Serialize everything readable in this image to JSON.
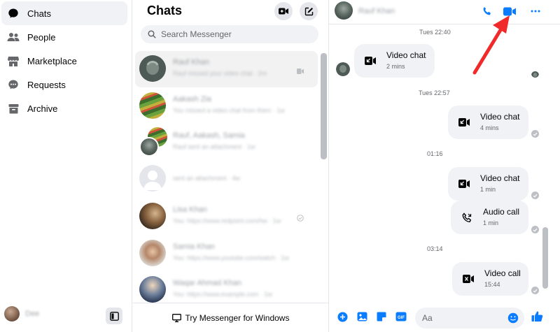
{
  "nav": {
    "items": [
      {
        "label": "Chats",
        "icon": "chat-bubble-icon",
        "active": true
      },
      {
        "label": "People",
        "icon": "people-icon",
        "active": false
      },
      {
        "label": "Marketplace",
        "icon": "marketplace-icon",
        "active": false
      },
      {
        "label": "Requests",
        "icon": "requests-icon",
        "active": false
      },
      {
        "label": "Archive",
        "icon": "archive-icon",
        "active": false
      }
    ],
    "username": "Dee"
  },
  "chat_list": {
    "title": "Chats",
    "search_placeholder": "Search Messenger",
    "conversations": [
      {
        "name": "Rauf Khan",
        "snippet": "Rauf missed your video chat · 2m",
        "active": true
      },
      {
        "name": "Aakash Zia",
        "snippet": "You missed a video chat from them · 1w",
        "active": false
      },
      {
        "name": "Rauf, Aakash, Samia",
        "snippet": "Rauf sent an attachment · 1w",
        "active": false
      },
      {
        "name": "",
        "snippet": "sent an attachment · 4w",
        "active": false
      },
      {
        "name": "Lisa Khan",
        "snippet": "You: https://www.redpoint.com/hw · 1w",
        "active": false
      },
      {
        "name": "Samia Khan",
        "snippet": "You: https://www.youtube.com/watch · 1w",
        "active": false
      },
      {
        "name": "Waqar Ahmad Khan",
        "snippet": "You: https://www.example.com · 1w",
        "active": false
      }
    ],
    "footer_label": "Try Messenger for Windows"
  },
  "conversation": {
    "contact_name": "Rauf Khan",
    "timestamps": [
      "Tues 22:40",
      "Tues 22:57",
      "01:16",
      "03:14"
    ],
    "messages": [
      {
        "title": "Video chat",
        "subtitle": "2 mins",
        "kind": "missed-video",
        "side": "left"
      },
      {
        "title": "Video chat",
        "subtitle": "4 mins",
        "kind": "missed-video",
        "side": "right"
      },
      {
        "title": "Video chat",
        "subtitle": "1 min",
        "kind": "missed-video",
        "side": "right"
      },
      {
        "title": "Audio call",
        "subtitle": "1 min",
        "kind": "audio",
        "side": "right"
      },
      {
        "title": "Video call",
        "subtitle": "15:44",
        "kind": "video-call",
        "side": "right"
      }
    ],
    "composer_placeholder": "Aa"
  },
  "colors": {
    "accent": "#0a7cff",
    "annotation": "#f02a2a",
    "bubble": "#f0f2f5"
  }
}
